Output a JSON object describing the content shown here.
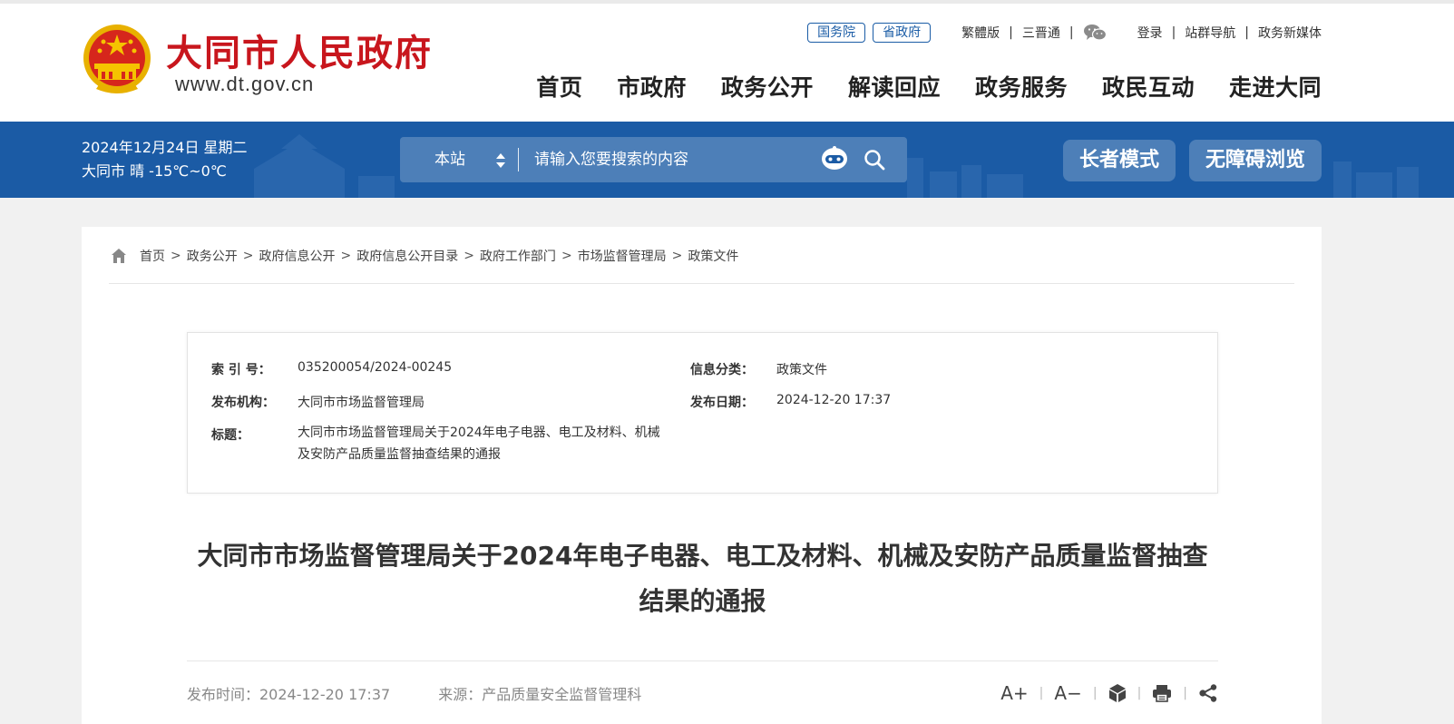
{
  "site": {
    "name": "大同市人民政府",
    "url": "www.dt.gov.cn"
  },
  "top_links": {
    "pill_1": "国务院",
    "pill_2": "省政府",
    "traditional": "繁體版",
    "sanjin": "三晋通",
    "login": "登录",
    "site_nav": "站群导航",
    "new_media": "政务新媒体"
  },
  "nav": [
    "首页",
    "市政府",
    "政务公开",
    "解读回应",
    "政务服务",
    "政民互动",
    "走进大同"
  ],
  "banner": {
    "date": "2024年12月24日 星期二",
    "weather": "大同市 晴 -15℃~0℃",
    "scope": "本站",
    "search_placeholder": "请输入您要搜索的内容",
    "elder_mode": "长者模式",
    "accessible": "无障碍浏览"
  },
  "breadcrumb": [
    "首页",
    "政务公开",
    "政府信息公开",
    "政府信息公开目录",
    "政府工作部门",
    "市场监督管理局",
    "政策文件"
  ],
  "meta": {
    "index_label": "索 引 号：",
    "index_value": "035200054/2024-00245",
    "category_label": "信息分类：",
    "category_value": "政策文件",
    "org_label": "发布机构：",
    "org_value": "大同市市场监督管理局",
    "date_label": "发布日期：",
    "date_value": "2024-12-20 17:37",
    "title_label": "标题：",
    "title_value": "大同市市场监督管理局关于2024年电子电器、电工及材料、机械及安防产品质量监督抽查结果的通报"
  },
  "doc": {
    "title": "大同市市场监督管理局关于2024年电子电器、电工及材料、机械及安防产品质量监督抽查结果的通报",
    "publish_time": "发布时间：2024-12-20 17:37",
    "source": "来源：产品质量安全监督管理科"
  },
  "tools": {
    "font_up": "A+",
    "font_down": "A−"
  },
  "colors": {
    "brand_red": "#c8161d",
    "banner_blue": "#1b5ba5"
  }
}
